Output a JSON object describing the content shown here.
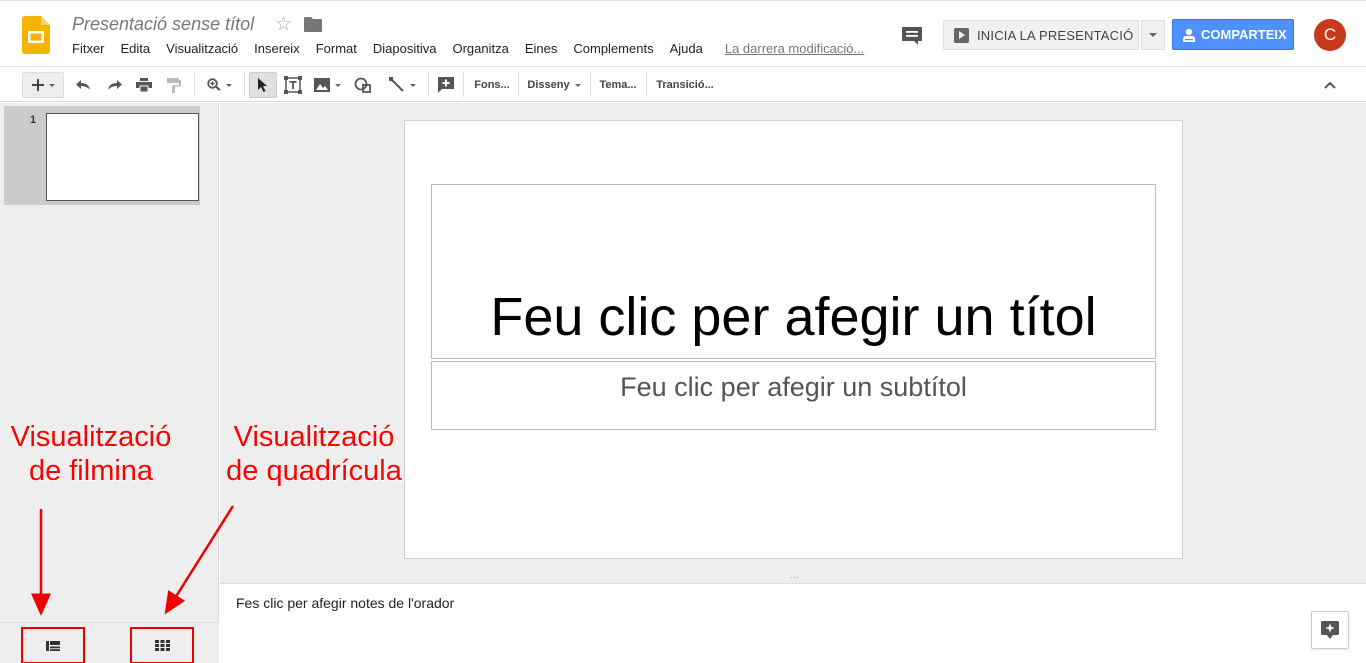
{
  "header": {
    "doc_title": "Presentació sense títol",
    "menu": [
      "Fitxer",
      "Edita",
      "Visualització",
      "Insereix",
      "Format",
      "Diapositiva",
      "Organitza",
      "Eines",
      "Complements",
      "Ajuda"
    ],
    "last_edit": "La darrera modificació...",
    "present_label": "INICIA LA PRESENTACIÓ",
    "share_label": "COMPARTEIX",
    "avatar_letter": "C"
  },
  "toolbar": {
    "background_label": "Fons...",
    "layout_label": "Disseny",
    "theme_label": "Tema...",
    "transition_label": "Transició..."
  },
  "filmstrip": {
    "slides": [
      {
        "number": "1"
      }
    ]
  },
  "slide": {
    "title_placeholder": "Feu clic per afegir un títol",
    "subtitle_placeholder": "Feu clic per afegir un subtítol"
  },
  "notes": {
    "placeholder": "Fes clic per afegir notes de l'orador"
  },
  "annotations": {
    "filmstrip_view_line1": "Visualització",
    "filmstrip_view_line2": "de filmina",
    "grid_view_line1": "Visualització",
    "grid_view_line2": "de quadrícula"
  },
  "colors": {
    "accent_share": "#4d90fe",
    "avatar": "#c8391c",
    "annotation": "#ff0000",
    "logo": "#f4b400"
  }
}
